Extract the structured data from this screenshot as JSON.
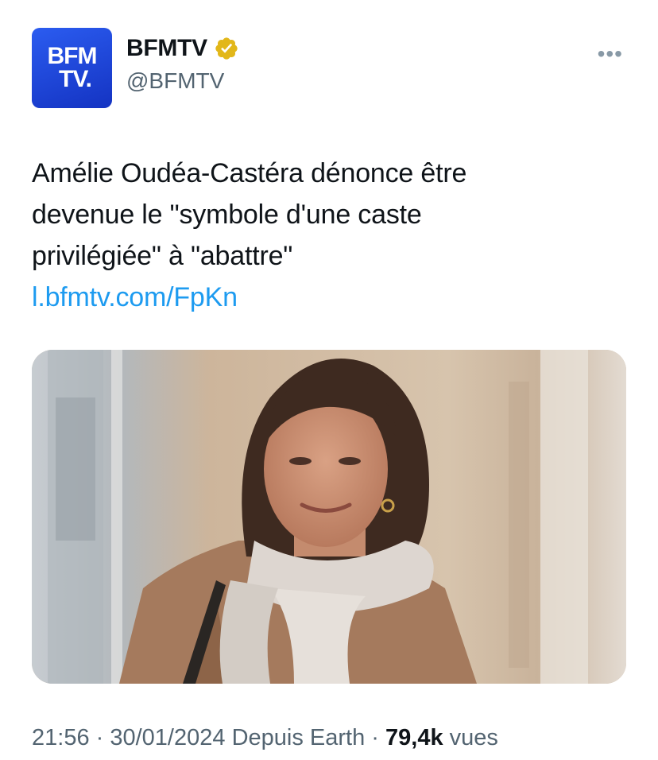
{
  "author": {
    "avatar_line1": "BFM",
    "avatar_line2": "TV.",
    "display_name": "BFMTV",
    "handle": "@BFMTV"
  },
  "more_label": "•••",
  "tweet": {
    "text_line1": "Amélie Oudéa-Castéra dénonce être",
    "text_line2": "devenue le \"symbole d'une caste",
    "text_line3": "privilégiée\" à \"abattre\"",
    "link": "l.bfmtv.com/FpKn"
  },
  "meta": {
    "time": "21:56",
    "sep1": " · ",
    "date": "30/01/2024",
    "source": " Depuis Earth",
    "sep2": " · ",
    "views_count": "79,4k",
    "views_label": " vues"
  },
  "colors": {
    "link": "#1d9bf0",
    "brand": "#1a44d6",
    "verified": "#e2b719",
    "secondary_text": "#536471"
  },
  "icons": {
    "verified": "verified-badge-icon",
    "more": "more-options-icon"
  }
}
